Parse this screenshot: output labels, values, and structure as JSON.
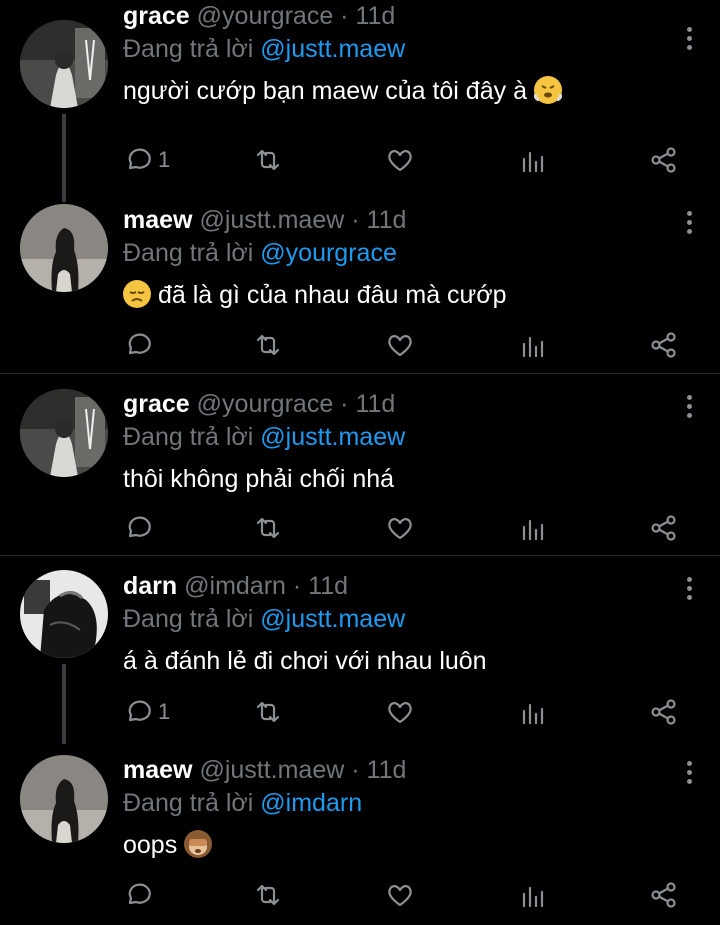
{
  "tweets": [
    {
      "name": "grace",
      "handle": "@yourgrace",
      "time": "11d",
      "reply_prefix": "Đang trả lời",
      "reply_to": "@justt.maew",
      "text": "người cướp bạn maew của tôi đây à",
      "emoji": "face-with-steam",
      "emoji_position": "after",
      "reply_count": "1",
      "avatar": "grace-avatar"
    },
    {
      "name": "maew",
      "handle": "@justt.maew",
      "time": "11d",
      "reply_prefix": "Đang trả lời",
      "reply_to": "@yourgrace",
      "text": "đã là gì của nhau đâu mà cướp",
      "emoji": "disappointed-face",
      "emoji_position": "before",
      "reply_count": "",
      "avatar": "maew-avatar"
    },
    {
      "name": "grace",
      "handle": "@yourgrace",
      "time": "11d",
      "reply_prefix": "Đang trả lời",
      "reply_to": "@justt.maew",
      "text": "thôi không phải chối nhá",
      "emoji": "",
      "reply_count": "",
      "avatar": "grace-avatar"
    },
    {
      "name": "darn",
      "handle": "@imdarn",
      "time": "11d",
      "reply_prefix": "Đang trả lời",
      "reply_to": "@justt.maew",
      "text": "á à đánh lẻ đi chơi với nhau luôn",
      "emoji": "",
      "reply_count": "1",
      "avatar": "darn-avatar"
    },
    {
      "name": "maew",
      "handle": "@justt.maew",
      "time": "11d",
      "reply_prefix": "Đang trả lời",
      "reply_to": "@imdarn",
      "text": "oops",
      "emoji": "see-no-evil-monkey",
      "emoji_position": "after",
      "reply_count": "",
      "avatar": "maew-avatar"
    }
  ],
  "separator": " · ",
  "colors": {
    "background": "#000000",
    "link": "#1d9bf0",
    "muted": "#71767b",
    "text": "#ffffff"
  }
}
